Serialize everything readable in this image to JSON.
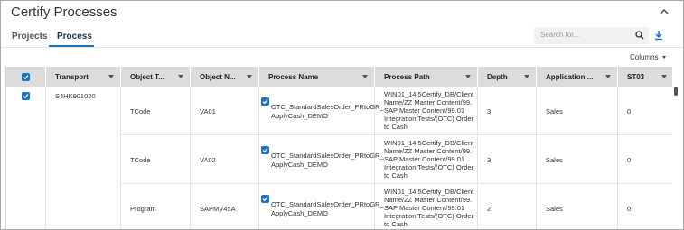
{
  "window": {
    "title": "Certify Processes"
  },
  "tabs": [
    {
      "label": "Projects",
      "active": false
    },
    {
      "label": "Process",
      "active": true
    }
  ],
  "toolbar": {
    "search_placeholder": "Search for...",
    "columns_label": "Columns"
  },
  "table": {
    "headers": [
      "Transport",
      "Object T...",
      "Object N...",
      "Process Name",
      "Process Path",
      "Depth",
      "Application ...",
      "ST03"
    ],
    "transport": "S4HK901020",
    "rows": [
      {
        "object_type": "TCode",
        "object_name": "VA01",
        "process_name_line1": "OTC_StandardSalesOrder_PRtoGR_",
        "process_name_line2": "ApplyCash_DEMO",
        "path_lines": [
          "WIN01_14.5Certify_DB/Client",
          "Name/ZZ Master Content/99.",
          "SAP Master Content/99.01",
          "Integration Tests/(OTC) Order",
          "to Cash"
        ],
        "depth": "3",
        "application": "Sales",
        "st03": "0"
      },
      {
        "object_type": "TCode",
        "object_name": "VA02",
        "process_name_line1": "OTC_StandardSalesOrder_PRtoGR_",
        "process_name_line2": "ApplyCash_DEMO",
        "path_lines": [
          "WIN01_14.5Certify_DB/Client",
          "Name/ZZ Master Content/99.",
          "SAP Master Content/99.01",
          "Integration Tests/(OTC) Order",
          "to Cash"
        ],
        "depth": "3",
        "application": "Sales",
        "st03": "0"
      },
      {
        "object_type": "Program",
        "object_name": "SAPMV45A",
        "process_name_line1": "OTC_StandardSalesOrder_PRtoGR_",
        "process_name_line2": "ApplyCash_DEMO",
        "path_lines": [
          "WIN01_14.5Certify_DB/Client",
          "Name/ZZ Master Content/99.",
          "SAP Master Content/99.01",
          "Integration Tests/(OTC) Order",
          "to Cash"
        ],
        "depth": "2",
        "application": "Sales",
        "st03": "0"
      }
    ]
  },
  "colors": {
    "accent": "#1a73c9",
    "header_bg": "#dcdcdc"
  },
  "icons": {
    "collapse": "chevron-up-icon",
    "search": "search-icon",
    "download": "download-icon",
    "column_menu": "caret-down-icon",
    "checkbox": "checkbox-checked-icon"
  }
}
